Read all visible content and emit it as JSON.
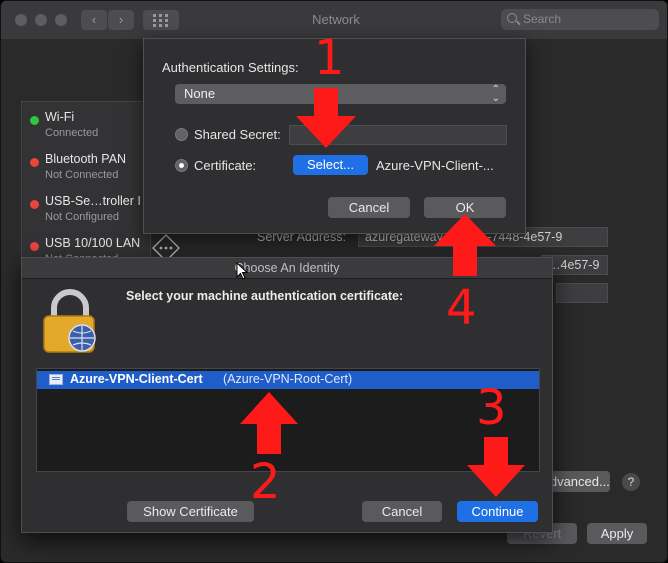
{
  "window": {
    "title": "Network",
    "search_placeholder": "Search"
  },
  "sidebar": {
    "items": [
      {
        "name": "Wi-Fi",
        "status": "Connected",
        "color": "#2ec541"
      },
      {
        "name": "Bluetooth PAN",
        "status": "Not Connected",
        "color": "#e8453c"
      },
      {
        "name": "USB-Se…troller I",
        "status": "Not Configured",
        "color": "#e8453c"
      },
      {
        "name": "USB 10/100 LAN",
        "status": "Not Connected",
        "color": "#e8453c"
      }
    ]
  },
  "details": {
    "server_address_label": "Server Address:",
    "server_address_value": "azuregateway-…0005-7448-4e57-9",
    "remote_id_value": "…4e57-9",
    "advanced_label": "Advanced...",
    "help_label": "?",
    "revert_label": "Revert",
    "apply_label": "Apply"
  },
  "auth_sheet": {
    "title": "Authentication Settings:",
    "method_selected": "None",
    "shared_secret_label": "Shared Secret:",
    "certificate_label": "Certificate:",
    "select_label": "Select...",
    "certificate_value": "Azure-VPN-Client-...",
    "cancel_label": "Cancel",
    "ok_label": "OK"
  },
  "identity_dialog": {
    "title": "Choose An Identity",
    "message": "Select your machine authentication certificate:",
    "certificates": [
      {
        "name": "Azure-VPN-Client-Cert",
        "issuer": "(Azure-VPN-Root-Cert)"
      }
    ],
    "show_certificate_label": "Show Certificate",
    "cancel_label": "Cancel",
    "continue_label": "Continue"
  },
  "annotations": {
    "step1": "1",
    "step2": "2",
    "step3": "3",
    "step4": "4",
    "arrow_color": "#ff1a1a"
  }
}
